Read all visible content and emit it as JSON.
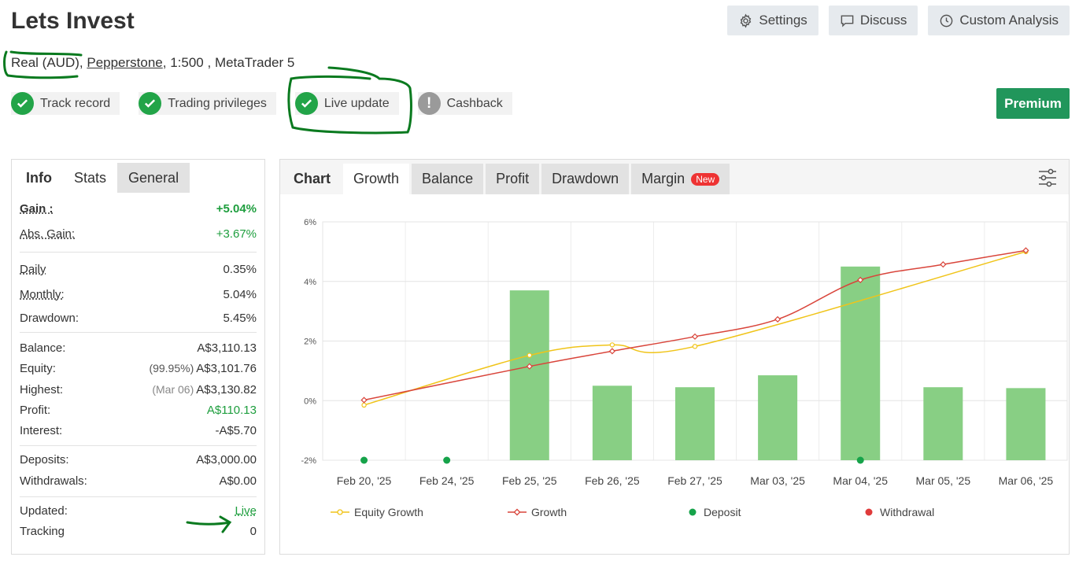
{
  "header": {
    "title": "Lets Invest",
    "buttons": [
      {
        "label": "Settings"
      },
      {
        "label": "Discuss"
      },
      {
        "label": "Custom Analysis"
      }
    ]
  },
  "account": {
    "type": "Real (AUD)",
    "broker": "Pepperstone",
    "leverage": "1:500",
    "platform": "MetaTrader 5"
  },
  "badges": [
    {
      "label": "Track record",
      "status": "ok"
    },
    {
      "label": "Trading privileges",
      "status": "ok"
    },
    {
      "label": "Live update",
      "status": "ok"
    },
    {
      "label": "Cashback",
      "status": "warn"
    }
  ],
  "premium_label": "Premium",
  "left_tabs": [
    "Info",
    "Stats",
    "General"
  ],
  "stats": {
    "gain_label": "Gain :",
    "gain": "+5.04%",
    "abs_gain_label": "Abs. Gain:",
    "abs_gain": "+3.67%",
    "daily_label": "Daily",
    "daily": "0.35%",
    "monthly_label": "Monthly:",
    "monthly": "5.04%",
    "drawdown_label": "Drawdown:",
    "drawdown": "5.45%",
    "balance_label": "Balance:",
    "balance": "A$3,110.13",
    "equity_label": "Equity:",
    "equity_pct": "(99.95%)",
    "equity": "A$3,101.76",
    "highest_label": "Highest:",
    "highest_date": "(Mar 06)",
    "highest": "A$3,130.82",
    "profit_label": "Profit:",
    "profit": "A$110.13",
    "interest_label": "Interest:",
    "interest": "-A$5.70",
    "deposits_label": "Deposits:",
    "deposits": "A$3,000.00",
    "withdrawals_label": "Withdrawals:",
    "withdrawals": "A$0.00",
    "updated_label": "Updated:",
    "updated": "Live",
    "tracking_label": "Tracking",
    "tracking": "0"
  },
  "chart_tabs": {
    "label": "Chart",
    "tabs": [
      "Growth",
      "Balance",
      "Profit",
      "Drawdown",
      "Margin"
    ],
    "new_badge": "New"
  },
  "colors": {
    "bar": "#88cf84",
    "growth": "#d9453b",
    "equity": "#f0c419",
    "deposit": "#16a34a",
    "withdrawal": "#e03b3b"
  },
  "chart_data": {
    "type": "line",
    "categories": [
      "Feb 20, '25",
      "Feb 24, '25",
      "Feb 25, '25",
      "Feb 26, '25",
      "Feb 27, '25",
      "Mar 03, '25",
      "Mar 04, '25",
      "Mar 05, '25",
      "Mar 06, '25"
    ],
    "ylim": [
      -2,
      6
    ],
    "yticks": [
      "6%",
      "4%",
      "2%",
      "0%",
      "-2%"
    ],
    "ytick_values": [
      6,
      4,
      2,
      0,
      -2
    ],
    "series": [
      {
        "name": "Equity Growth",
        "kind": "line",
        "values": [
          -0.15,
          null,
          1.52,
          1.87,
          1.82,
          null,
          null,
          null,
          5.0
        ]
      },
      {
        "name": "Growth",
        "kind": "line",
        "values": [
          0.02,
          null,
          1.15,
          1.66,
          2.15,
          2.73,
          4.05,
          4.57,
          5.04
        ]
      },
      {
        "name": "Deposit",
        "kind": "marker",
        "values": [
          -2,
          -2,
          null,
          null,
          null,
          null,
          -2,
          null,
          null
        ]
      },
      {
        "name": "Withdrawal",
        "kind": "marker",
        "values": [
          null,
          null,
          null,
          null,
          null,
          null,
          null,
          null,
          null
        ]
      }
    ],
    "bars": [
      null,
      null,
      3.7,
      0.5,
      0.45,
      0.85,
      4.5,
      0.45,
      0.42
    ],
    "grid": true,
    "legend": "bottom"
  }
}
